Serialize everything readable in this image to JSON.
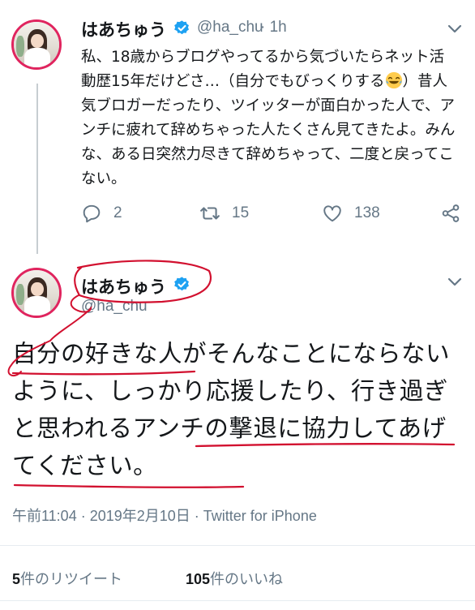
{
  "tweet1": {
    "name": "はあちゅう",
    "handle": "@ha_chu",
    "time": "· 1h",
    "text_a": "私、18歳からブログやってるから気づいたらネット活動歴15年だけどさ…（自分でもびっくりする",
    "emoji": "face-with-tears-of-joy",
    "text_b": "）昔人気ブロガーだったり、ツイッターが面白かった人で、アンチに疲れて辞めちゃった人たくさん見てきたよ。みんな、ある日突然力尽きて辞めちゃって、二度と戻ってこない。",
    "actions": {
      "replies": "2",
      "retweets": "15",
      "likes": "138"
    }
  },
  "tweet2": {
    "name": "はあちゅう",
    "handle": "@ha_chu",
    "text": {
      "s1": "自分の好きな人",
      "s2": "がそんなことにならないように、しっかり応援したり、行き過ぎと思われる",
      "s3": "アンチの撃退に協力してあげてください。"
    },
    "meta": "午前11:04 · 2019年2月10日 · Twitter for iPhone",
    "stats": {
      "retweets_count": "5",
      "retweets_label": "件のリツイート",
      "likes_count": "105",
      "likes_label": "件のいいね"
    }
  },
  "colors": {
    "annotation_red": "#d2102f",
    "verified_blue": "#1da1f2",
    "muted": "#657786",
    "text": "#14171a"
  }
}
